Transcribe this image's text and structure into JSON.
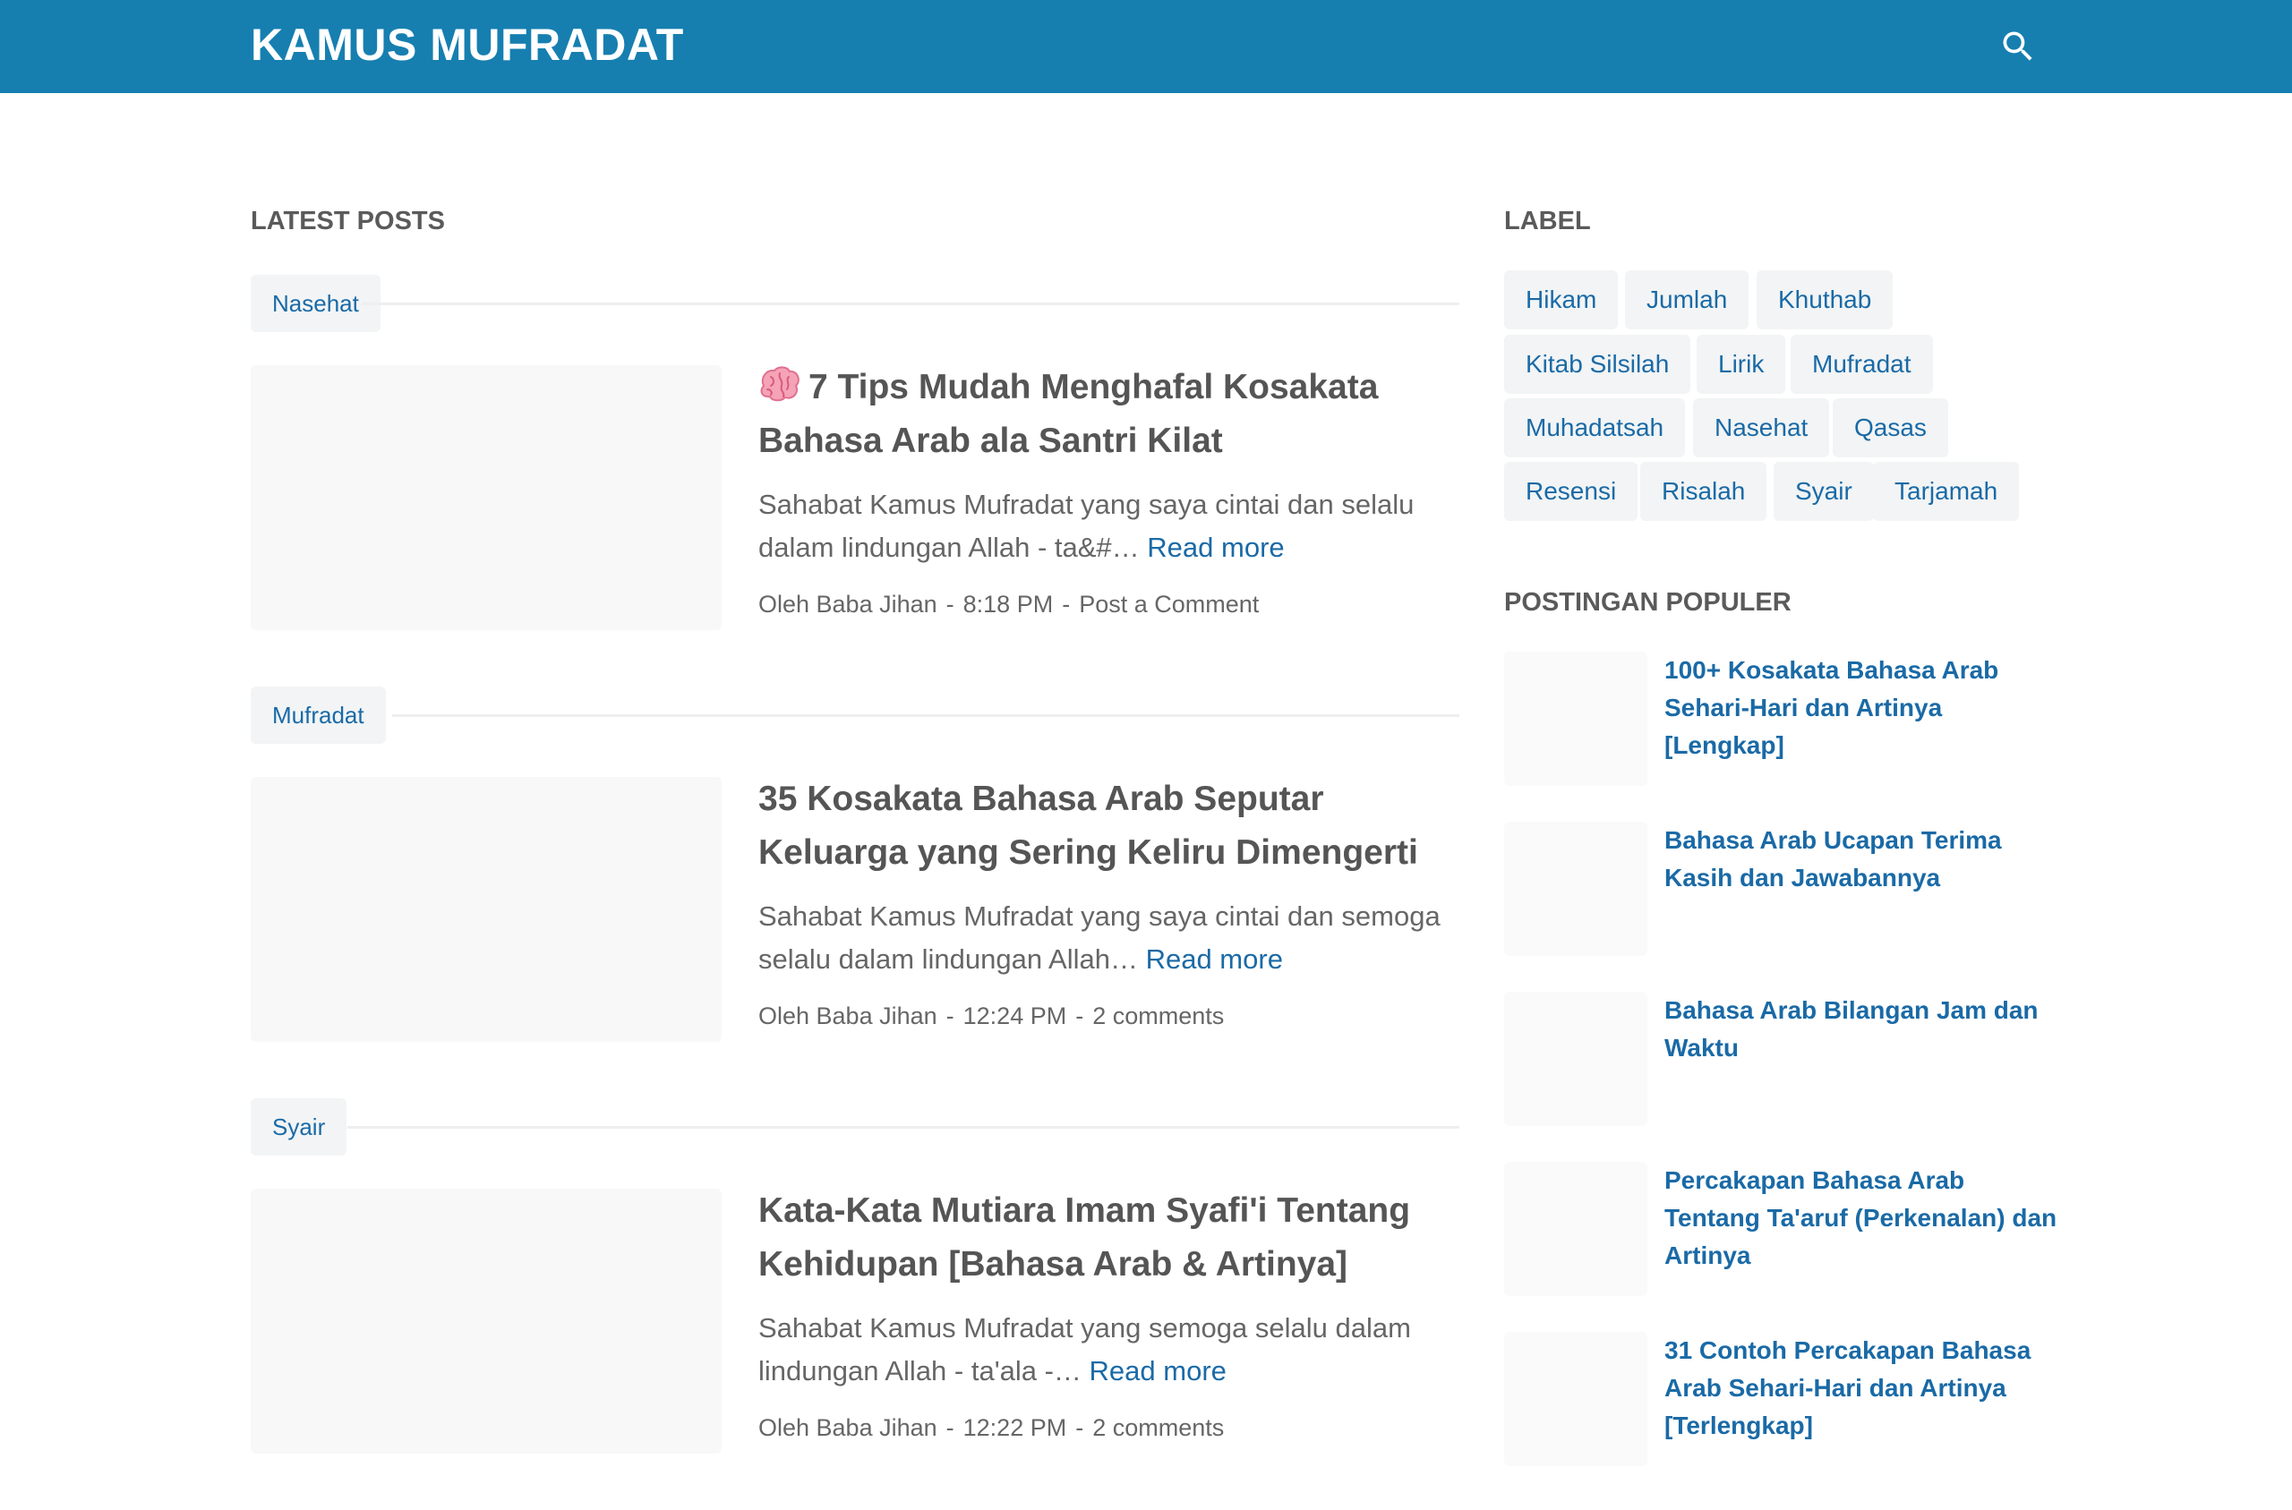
{
  "header": {
    "site_title": "KAMUS MUFRADAT",
    "search_icon": "search-icon",
    "bg_color": "#167fb0"
  },
  "main": {
    "section_title": "LATEST POSTS",
    "posts": [
      {
        "label": "Nasehat",
        "title_icon": "brain-emoji-icon",
        "title": "7 Tips Mudah Menghafal Kosakata Bahasa Arab ala Santri Kilat",
        "snippet": "Sahabat Kamus Mufradat yang saya cintai dan selalu dalam lindungan Allah - ta&#…",
        "read_more": "Read more",
        "author": "Oleh Baba Jihan",
        "time": "8:18 PM",
        "comments": "Post a Comment"
      },
      {
        "label": "Mufradat",
        "title": "35 Kosakata Bahasa Arab Seputar Keluarga yang Sering Keliru Dimengerti",
        "snippet": "Sahabat Kamus Mufradat yang saya cintai dan semoga selalu dalam lindungan Allah…",
        "read_more": "Read more",
        "author": "Oleh Baba Jihan",
        "time": "12:24 PM",
        "comments": "2 comments"
      },
      {
        "label": "Syair",
        "title": "Kata-Kata Mutiara Imam Syafi'i Tentang Kehidupan [Bahasa Arab & Artinya]",
        "snippet": "Sahabat Kamus Mufradat yang semoga selalu dalam lindungan Allah - ta'ala -…",
        "read_more": "Read more",
        "author": "Oleh Baba Jihan",
        "time": "12:22 PM",
        "comments": "2 comments"
      }
    ]
  },
  "sidebar": {
    "label_title": "LABEL",
    "labels": [
      "Hikam",
      "Jumlah",
      "Khuthab",
      "Kitab Silsilah",
      "Lirik",
      "Mufradat",
      "Muhadatsah",
      "Nasehat",
      "Qasas",
      "Resensi",
      "Risalah",
      "Syair",
      "Tarjamah"
    ],
    "popular_title": "POSTINGAN POPULER",
    "popular": [
      "100+ Kosakata Bahasa Arab Sehari-Hari dan Artinya [Lengkap]",
      "Bahasa Arab Ucapan Terima Kasih dan Jawabannya",
      "Bahasa Arab Bilangan Jam dan Waktu",
      "Percakapan Bahasa Arab Tentang Ta'aruf (Perkenalan) dan Artinya",
      "31 Contoh Percakapan Bahasa Arab Sehari-Hari dan Artinya [Terlengkap]"
    ]
  },
  "colors": {
    "accent": "#167fb0",
    "link": "#1a6aa6",
    "text": "#555555",
    "chip_bg": "#f2f4f5"
  }
}
